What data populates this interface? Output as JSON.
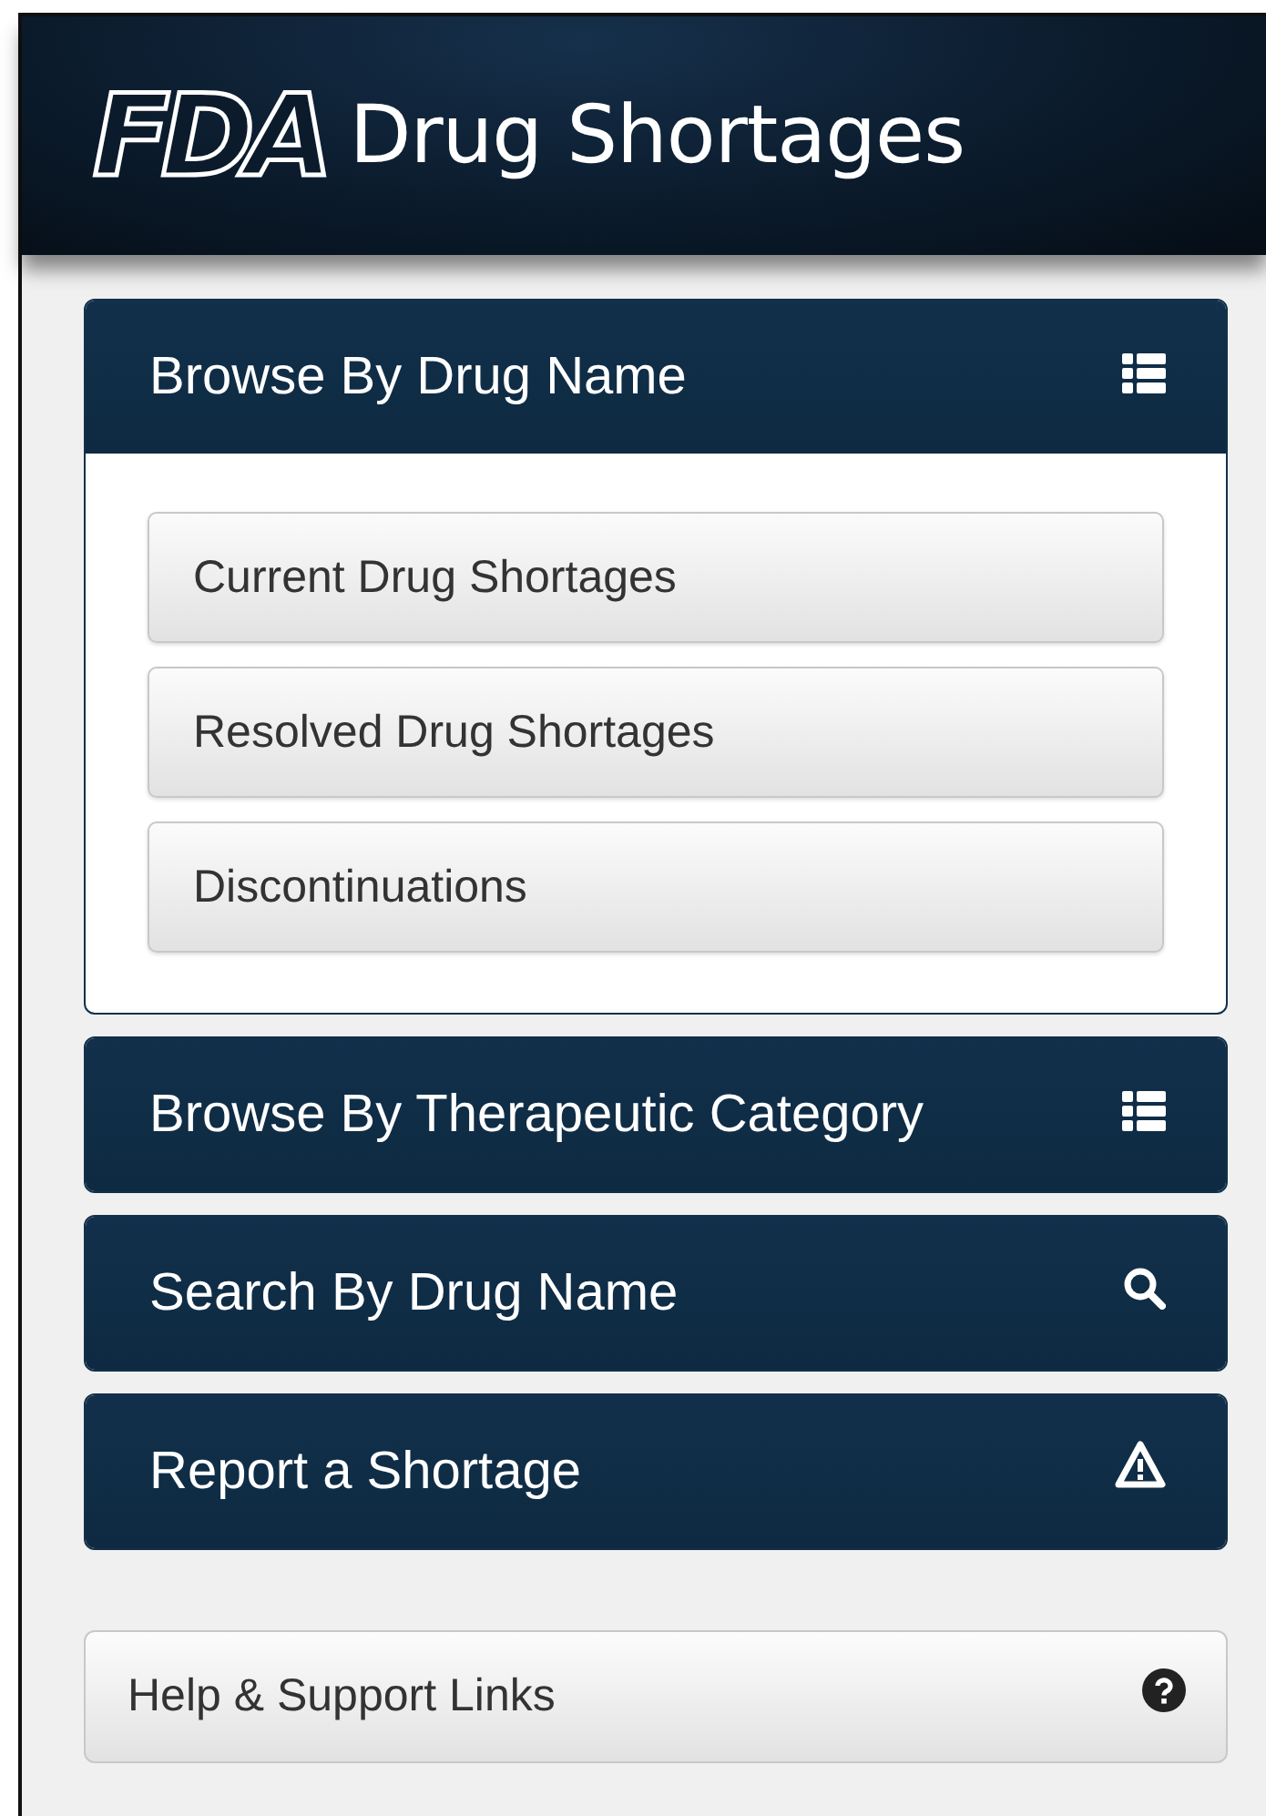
{
  "header": {
    "logo": "FDA",
    "title": "Drug Shortages"
  },
  "panels": [
    {
      "title": "Browse By Drug Name",
      "kind": "list",
      "expanded": true,
      "items": [
        "Current Drug Shortages",
        "Resolved Drug Shortages",
        "Discontinuations"
      ]
    },
    {
      "title": "Browse By Therapeutic Category",
      "kind": "list",
      "expanded": false
    },
    {
      "title": "Search By Drug Name",
      "kind": "search",
      "expanded": false
    },
    {
      "title": "Report a Shortage",
      "kind": "warning",
      "expanded": false
    }
  ],
  "help": {
    "label": "Help & Support Links"
  }
}
